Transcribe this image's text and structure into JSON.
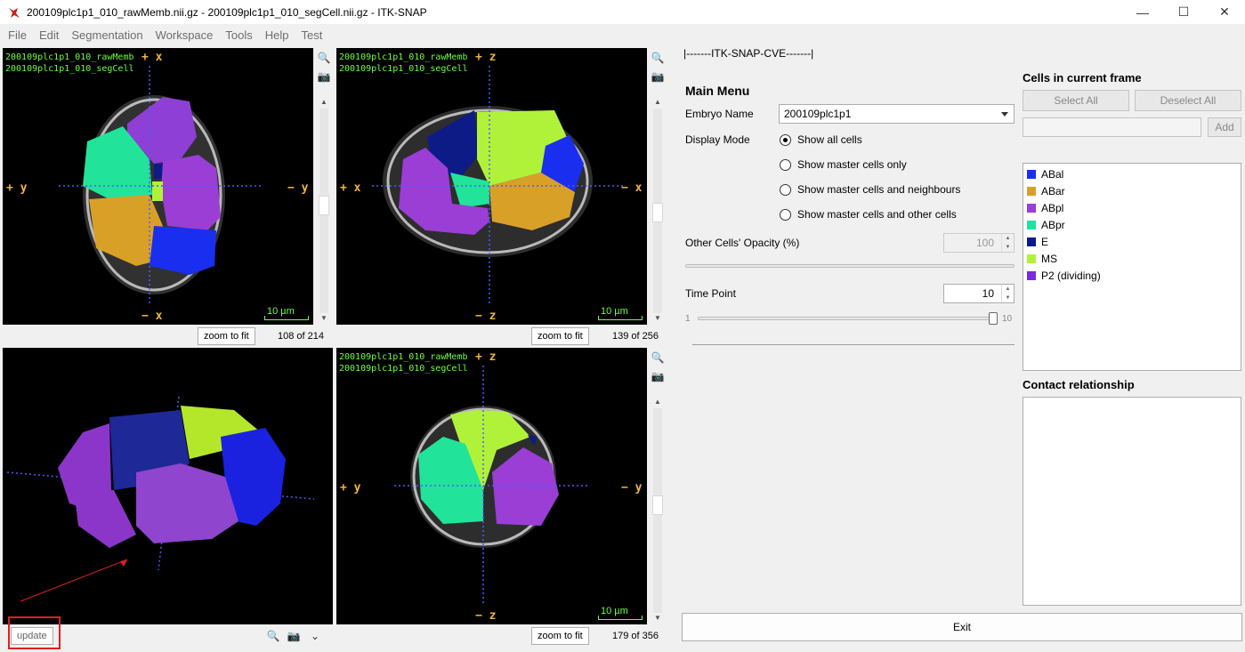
{
  "window": {
    "title": "200109plc1p1_010_rawMemb.nii.gz - 200109plc1p1_010_segCell.nii.gz - ITK-SNAP",
    "minimize": "—",
    "maximize": "☐",
    "close": "✕"
  },
  "menu": [
    "File",
    "Edit",
    "Segmentation",
    "Workspace",
    "Tools",
    "Help",
    "Test"
  ],
  "views": {
    "top_left": {
      "layer1": "200109plc1p1_010_rawMemb",
      "layer2": "200109plc1p1_010_segCell",
      "axis_top": "+ x",
      "axis_bottom": "− x",
      "axis_left": "+ y",
      "axis_right": "− y",
      "scale": "10 µm",
      "zoom_label": "zoom to fit",
      "slice": "108 of 214"
    },
    "top_right": {
      "layer1": "200109plc1p1_010_rawMemb",
      "layer2": "200109plc1p1_010_segCell",
      "axis_top": "+ z",
      "axis_bottom": "− z",
      "axis_left": "+ x",
      "axis_right": "− x",
      "scale": "10 µm",
      "zoom_label": "zoom to fit",
      "slice": "139 of 256"
    },
    "bottom_left": {
      "update_label": "update"
    },
    "bottom_right": {
      "layer1": "200109plc1p1_010_rawMemb",
      "layer2": "200109plc1p1_010_segCell",
      "axis_top": "+ z",
      "axis_bottom": "− z",
      "axis_left": "+ y",
      "axis_right": "− y",
      "scale": "10 µm",
      "zoom_label": "zoom to fit",
      "slice": "179 of 356"
    }
  },
  "panel": {
    "header": "|-------ITK-SNAP-CVE-------|",
    "main_menu": "Main Menu",
    "embryo_label": "Embryo Name",
    "embryo_value": "200109plc1p1",
    "display_mode_label": "Display Mode",
    "display_modes": [
      "Show all cells",
      "Show master cells only",
      "Show master cells and neighbours",
      "Show master cells and other cells"
    ],
    "opacity_label": "Other Cells' Opacity (%)",
    "opacity_value": "100",
    "time_label": "Time Point",
    "time_value": "10",
    "time_min": "1",
    "time_max": "10",
    "time_position": 1.0,
    "exit_label": "Exit"
  },
  "cells_panel": {
    "title": "Cells in current frame",
    "select_all": "Select All",
    "deselect_all": "Deselect All",
    "add": "Add",
    "cells": [
      {
        "name": "ABal",
        "color": "#1a2ef0"
      },
      {
        "name": "ABar",
        "color": "#d9a028"
      },
      {
        "name": "ABpl",
        "color": "#9a3ed6"
      },
      {
        "name": "ABpr",
        "color": "#1ee3a0"
      },
      {
        "name": "E",
        "color": "#0a1a8a"
      },
      {
        "name": "MS",
        "color": "#b0f23a"
      },
      {
        "name": "P2 (dividing)",
        "color": "#7a2be0"
      }
    ],
    "contact_title": "Contact relationship"
  }
}
